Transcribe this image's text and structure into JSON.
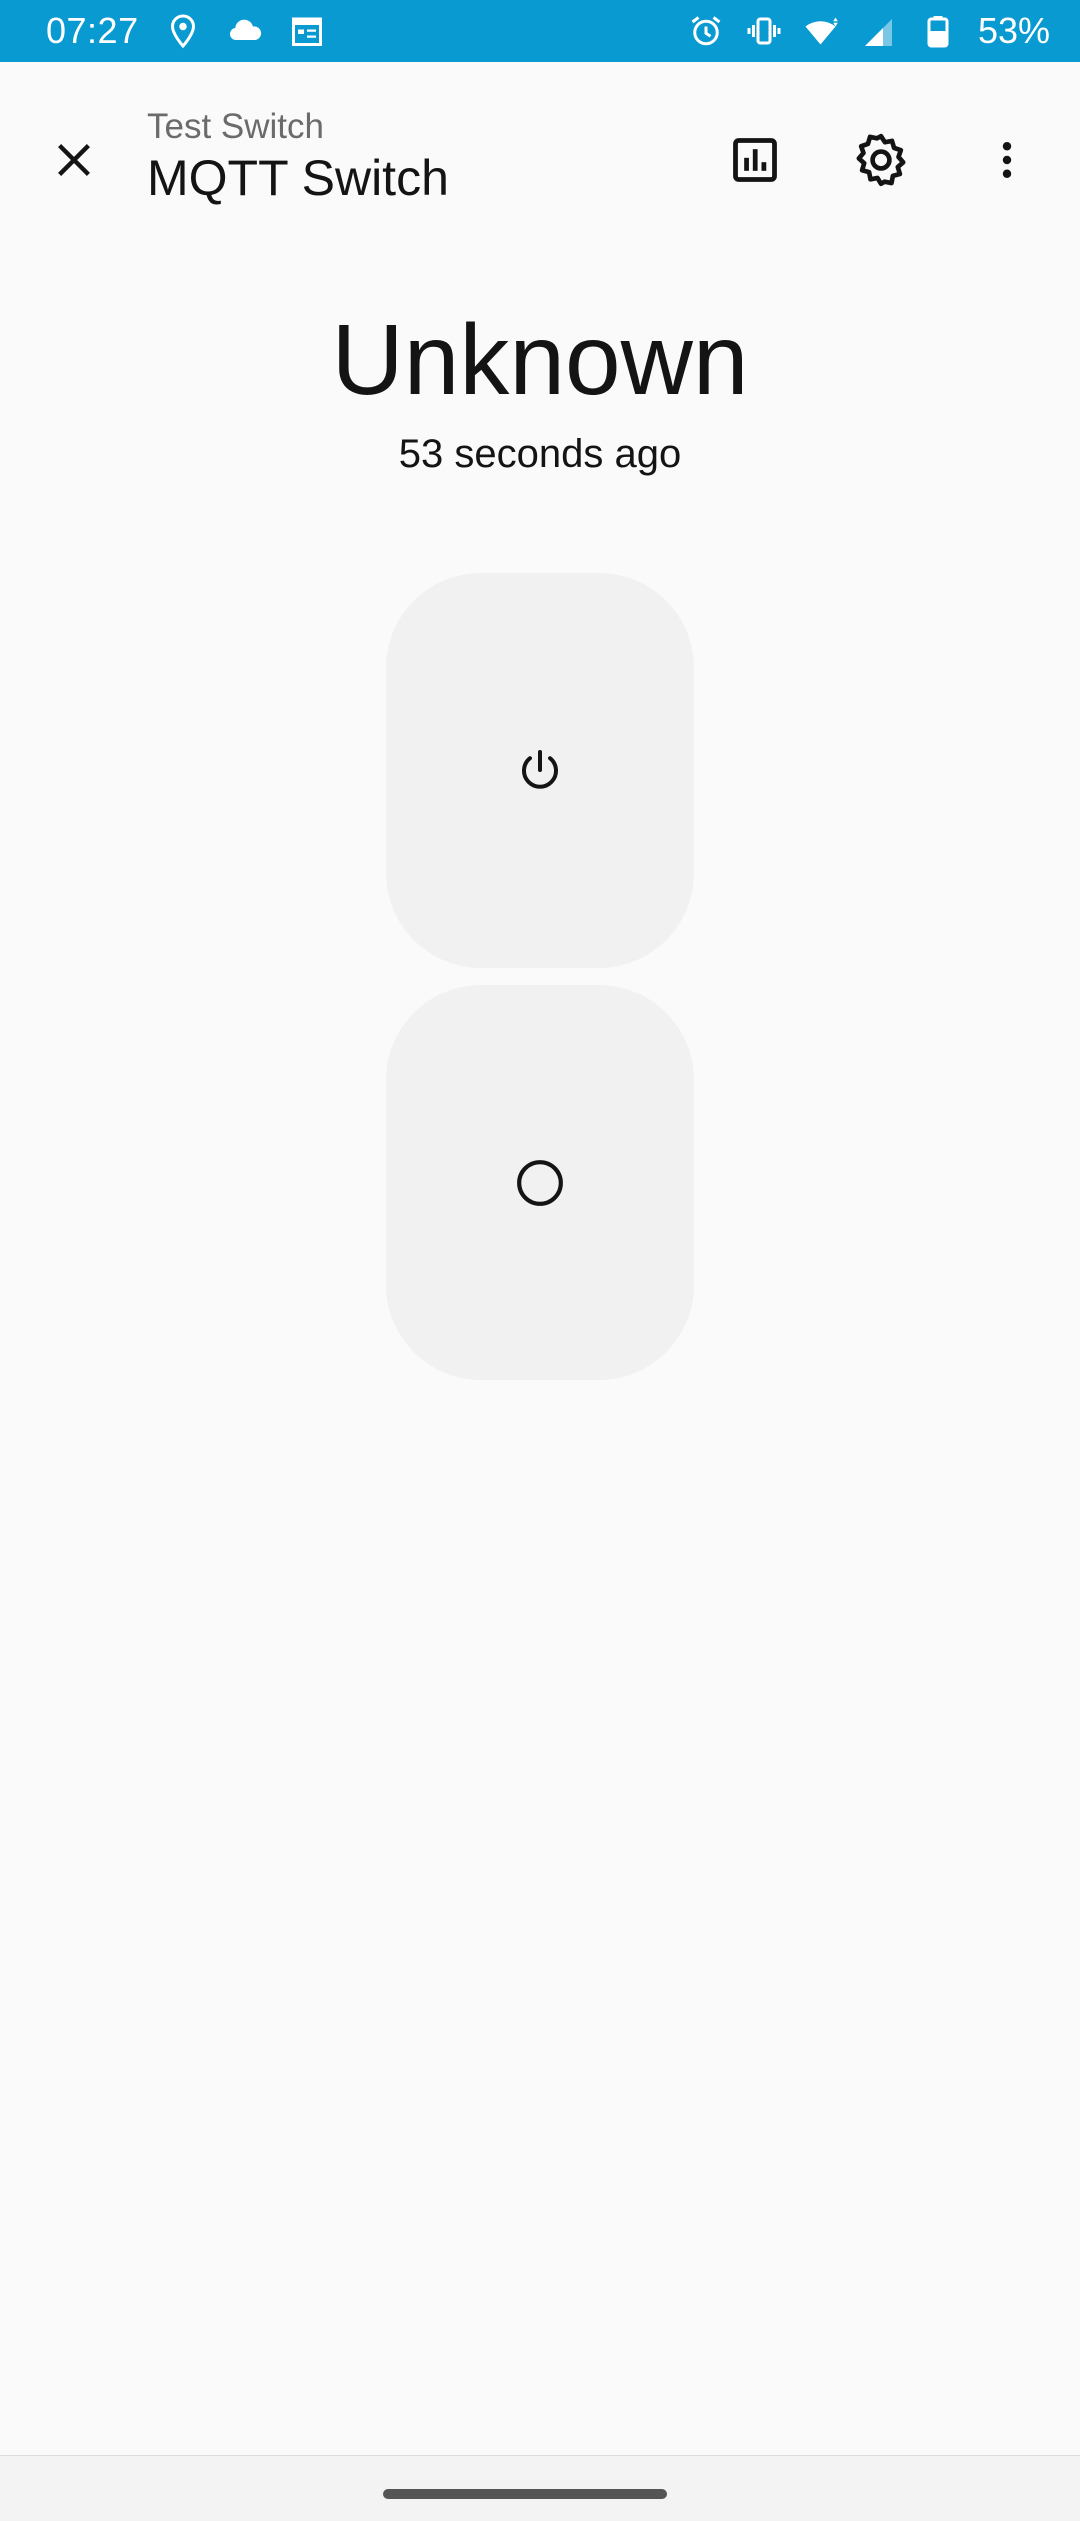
{
  "status_bar": {
    "time": "07:27",
    "battery": "53%",
    "background": "#0a9ad2",
    "icons_left": [
      "location-icon",
      "cloud-icon",
      "calendar-icon"
    ],
    "icons_right": [
      "alarm-icon",
      "vibrate-icon",
      "wifi-icon",
      "cell-signal-icon",
      "battery-icon"
    ]
  },
  "app_bar": {
    "subtitle": "Test Switch",
    "title": "MQTT Switch",
    "icons": [
      "close-icon",
      "history-chart-icon",
      "settings-gear-icon",
      "overflow-menu-icon"
    ]
  },
  "entity": {
    "state": "Unknown",
    "last_changed": "53 seconds ago"
  },
  "controls": {
    "on_icon": "power-icon",
    "off_icon": "circle-icon"
  }
}
